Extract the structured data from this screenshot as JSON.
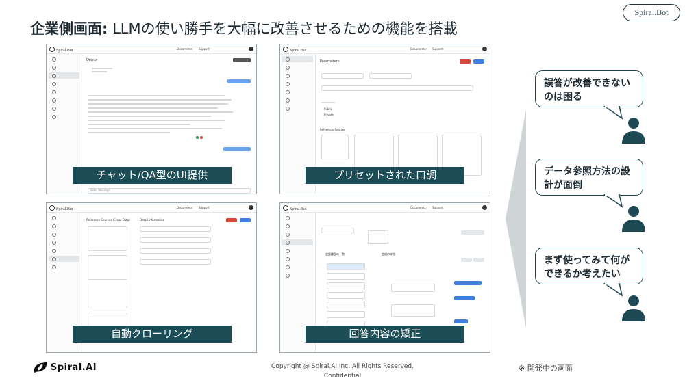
{
  "slide": {
    "title_bold": "企業側画面:",
    "title_rest": "LLMの使い勝手を大幅に改善させるための機能を搭載",
    "brand_pill": "Spiral.Bot"
  },
  "app": {
    "logo": "Spiral.Bot",
    "nav_docs": "Documents",
    "nav_support": "Support"
  },
  "screens": [
    {
      "caption": "チャット/QA型のUI提供",
      "header": "Demo",
      "input_placeholder": "Send Message"
    },
    {
      "caption": "プリセットされた口調",
      "header": "Parameters",
      "radio_options": [
        "Public",
        "Private"
      ],
      "section": "Reference Sources"
    },
    {
      "caption": "自動クローリング",
      "header": "Reference Sources (Crawl Data)",
      "panel_title": "Detail Information"
    },
    {
      "caption": "回答内容の矯正",
      "col_left": "会話履歴の一覧",
      "col_right": "会話の詳細"
    }
  ],
  "bubbles": [
    {
      "text": "誤答が改善できないのは困る"
    },
    {
      "text": "データ参照方法の設計が面倒"
    },
    {
      "text": "まず使ってみて何ができるか考えたい"
    }
  ],
  "footer": {
    "logo_text": "Spiral.AI",
    "copyright_line1": "Copyright @ Spiral.AI Inc. All Rights Reserved.",
    "copyright_line2": "Confidential",
    "dev_note": "※ 開発中の画面"
  },
  "colors": {
    "caption_bg": "#1c4d56",
    "bubble_border": "#1f4855",
    "person": "#1f4855",
    "accent_blue": "#3f7fe0",
    "accent_red": "#d9473b"
  }
}
